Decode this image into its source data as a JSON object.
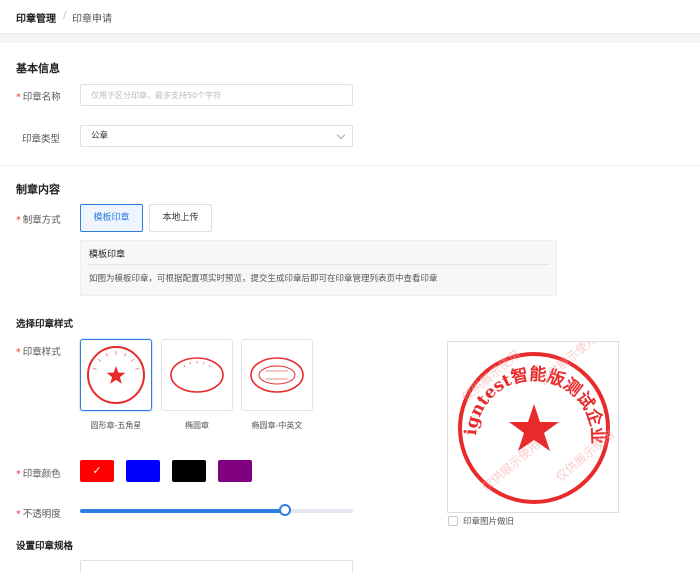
{
  "breadcrumb": {
    "current": "印章管理",
    "separator": "/",
    "sub": "印章申请"
  },
  "basic": {
    "title": "基本信息",
    "name_label": "印章名称",
    "name_value": "",
    "name_placeholder": "仅用于区分印章，最多支持50个字符",
    "type_label": "印章类型",
    "type_value": "公章"
  },
  "make": {
    "title": "制章内容",
    "method_label": "制章方式",
    "methods": [
      {
        "label": "模板印章",
        "active": true
      },
      {
        "label": "本地上传",
        "active": false
      }
    ],
    "tip_title": "模板印章",
    "tip_text": "如图为模板印章，可根据配置项实时预览，提交生成印章后即可在印章管理列表页中查看印章"
  },
  "style": {
    "title": "选择印章样式",
    "style_label": "印章样式",
    "styles": [
      {
        "caption": "圆形章-五角星",
        "active": true
      },
      {
        "caption": "椭圆章",
        "active": false
      },
      {
        "caption": "椭圆章-中英文",
        "active": false
      }
    ],
    "color_label": "印章颜色",
    "colors": [
      {
        "name": "red",
        "hex": "#ff0000",
        "selected": true
      },
      {
        "name": "blue",
        "hex": "#0000ff",
        "selected": false
      },
      {
        "name": "black",
        "hex": "#000000",
        "selected": false
      },
      {
        "name": "purple",
        "hex": "#800080",
        "selected": false
      }
    ],
    "check_glyph": "✓",
    "opacity_label": "不透明度",
    "opacity_value": 0.75
  },
  "preview": {
    "text": "esigntest智能版测试企业1",
    "watermark": "仅供展示使用",
    "seal_color": "#e82a2a",
    "aged_label": "印章图片做旧",
    "aged_checked": false
  },
  "spec": {
    "title": "设置印章规格"
  }
}
